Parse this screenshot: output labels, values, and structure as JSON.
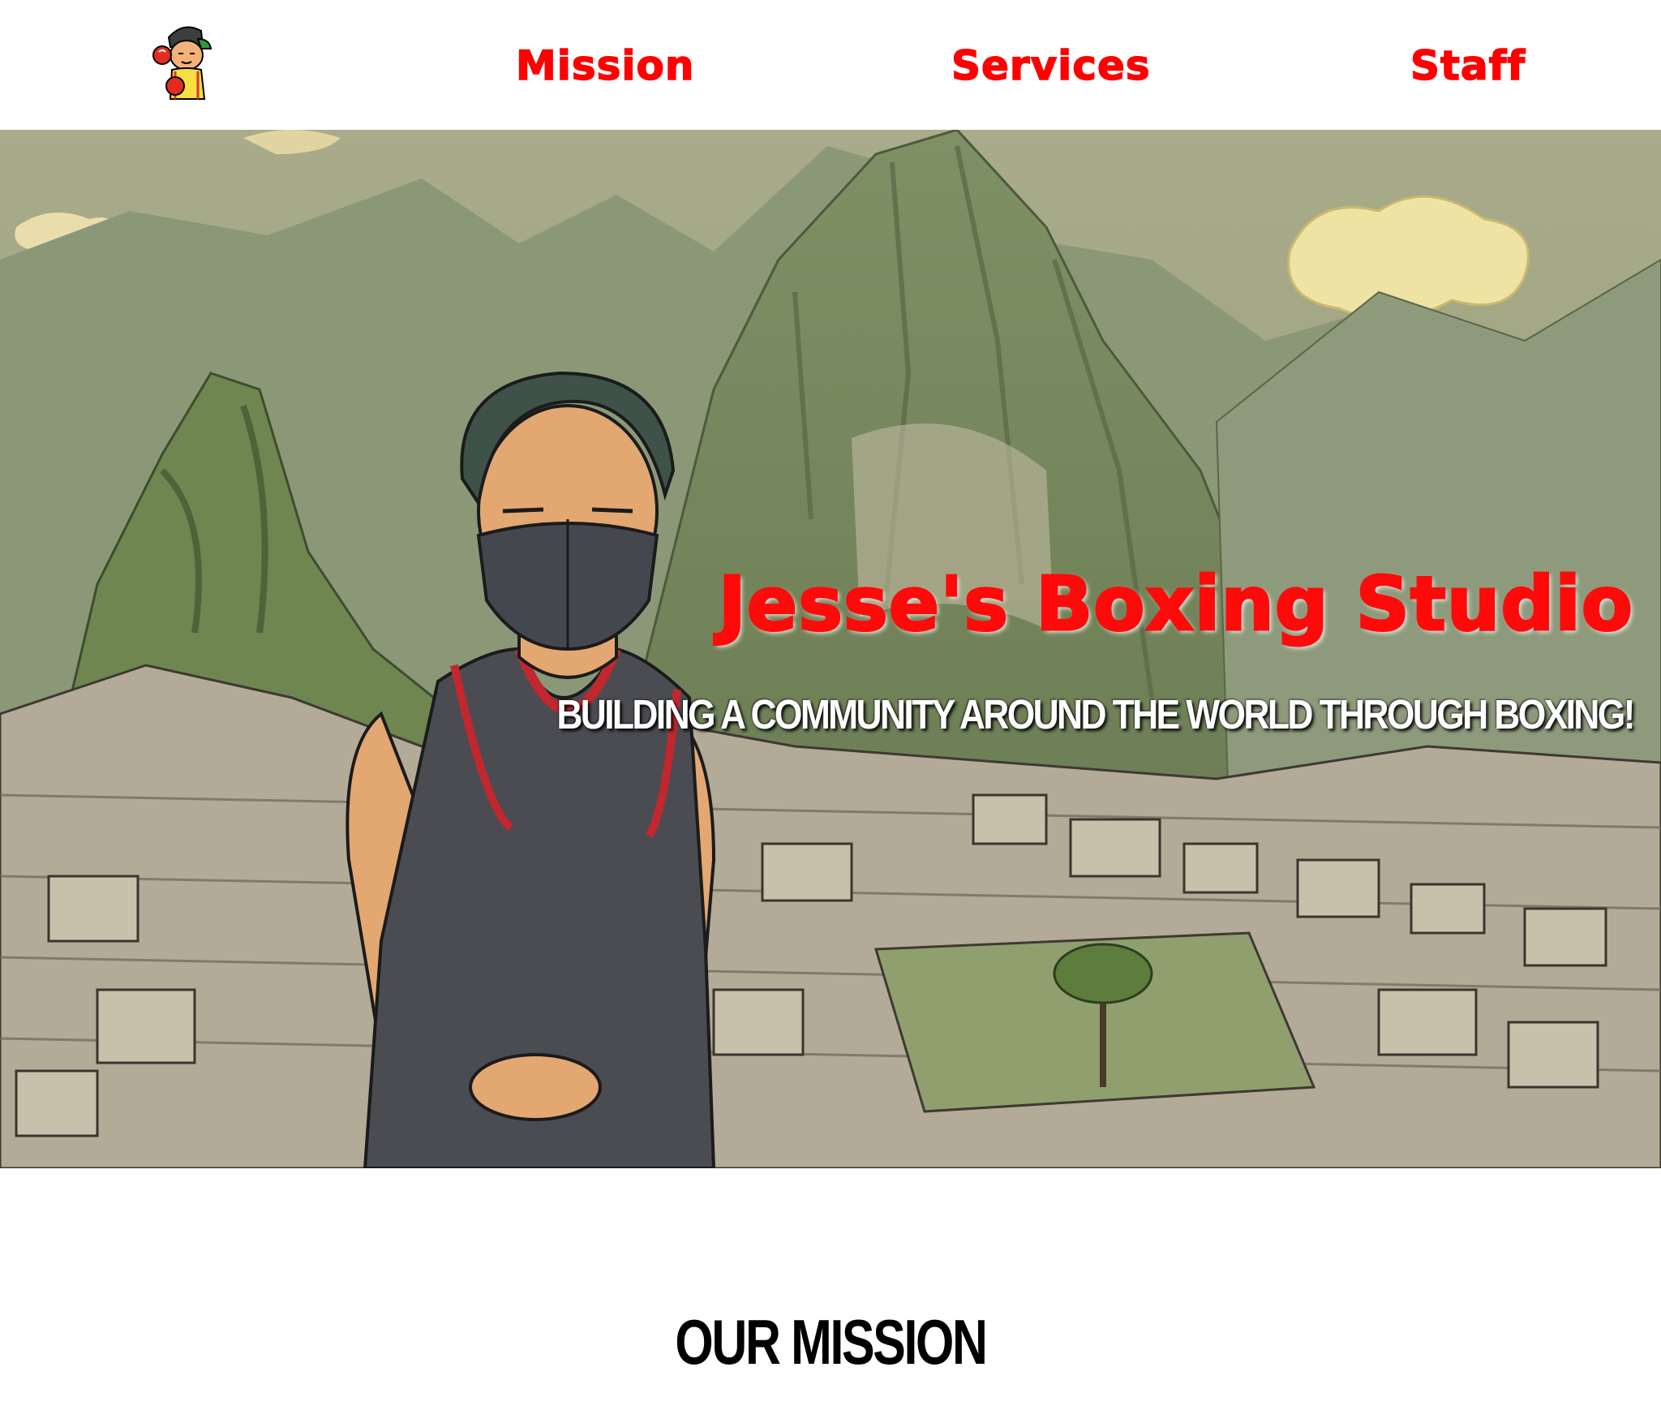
{
  "header": {
    "logo_icon": "boxer-mascot-icon",
    "nav": [
      {
        "label": "Mission"
      },
      {
        "label": "Services"
      },
      {
        "label": "Staff"
      }
    ]
  },
  "hero": {
    "title": "Jesse's Boxing Studio",
    "subtitle": "BUILDING A COMMUNITY AROUND THE WORLD THROUGH BOXING!",
    "image_icon": "hero-illustration-mountain-ruins-boxer"
  },
  "mission": {
    "heading": "OUR MISSION"
  },
  "colors": {
    "accent": "#ff0000",
    "background": "#ffffff",
    "heading": "#000000"
  }
}
